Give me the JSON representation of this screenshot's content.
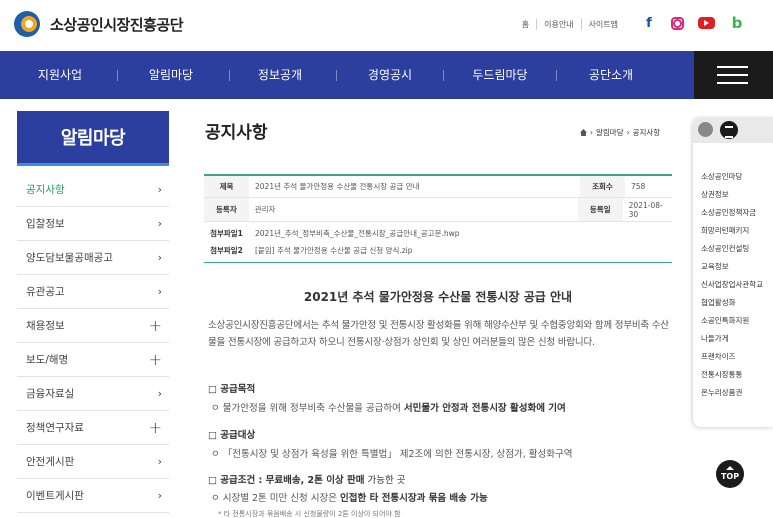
{
  "header": {
    "logo_text": "소상공인시장진흥공단",
    "top_links": [
      "홈",
      "이용안내",
      "사이트맵"
    ],
    "sns": [
      "facebook-icon",
      "instagram-icon",
      "youtube-icon",
      "blog-icon"
    ]
  },
  "nav": {
    "items": [
      "지원사업",
      "알림마당",
      "정보공개",
      "경영공시",
      "두드림마당",
      "공단소개"
    ]
  },
  "sidebar": {
    "title": "알림마당",
    "items": [
      {
        "label": "공지사항",
        "icon": "›"
      },
      {
        "label": "입찰정보",
        "icon": "›"
      },
      {
        "label": "양도담보물공매공고",
        "icon": "›"
      },
      {
        "label": "유관공고",
        "icon": "›"
      },
      {
        "label": "채용정보",
        "icon": "+"
      },
      {
        "label": "보도/해명",
        "icon": "+"
      },
      {
        "label": "금융자료실",
        "icon": "›"
      },
      {
        "label": "정책연구자료",
        "icon": "+"
      },
      {
        "label": "안전게시판",
        "icon": "›"
      },
      {
        "label": "이벤트게시판",
        "icon": "›"
      }
    ]
  },
  "main": {
    "title": "공지사항",
    "breadcrumb": [
      "알림마당",
      "공지사항"
    ],
    "info": {
      "subject_label": "제목",
      "subject": "2021년 추석 물가안정용 수산물 전통시장 공급 안내",
      "views_label": "조회수",
      "views": "758",
      "author_label": "등록자",
      "author": "관리자",
      "date_label": "등록일",
      "date": "2021-08-30",
      "file1_label": "첨부파일1",
      "file1": "2021년_추석_정부비축_수산물_전통시장_공급안내_공고문.hwp",
      "file2_label": "첨부파일2",
      "file2": "[붙임] 추석 물가안정용 수산물 공급 신청 양식.zip"
    },
    "article": {
      "title": "2021년 추석 물가안정용 수산물 전통시장 공급 안내",
      "paragraph": "소상공인시장진흥공단에서는 추석 물가안정 및 전통시장 활성화를 위해 해양수산부 및 수협중앙회와 함께 정부비축 수산물을 전통시장에 공급하고자 하오니 전통시장·상점가 상인회 및 상인 여러분들의 많은 신청 바랍니다.",
      "sec1": "□ 공급목적",
      "sec1_bullet_a": "ㅇ 물가안정을 위해 정부비축 수산물을 공급하여 ",
      "sec1_bullet_b": "서민물가 안정과 전통시장 활성화에 기여",
      "sec2": "□ 공급대상",
      "sec2_bullet": "ㅇ 「전통시장 및 상점가 육성을 위한 특별법」 제2조에 의한 전통시장, 상점가, 활성화구역",
      "sec3_a": "□ 공급조건 : 무료배송, 2톤 이상 판매",
      "sec3_b": " 가능한 곳",
      "sec3_bullet_a": "ㅇ 시장별 2톤 미만 신청 시장은 ",
      "sec3_bullet_b": "인접한 타 전통시장과 묶음 배송 가능",
      "note": "* 타 전통시장과 묶음배송 시 신청물량이 2톤 이상이 되어야 함"
    }
  },
  "quick": {
    "items": [
      "소상공인마당",
      "상권정보",
      "소상공인정책자금",
      "희망리턴패키지",
      "소상공인컨설팅",
      "교육정보",
      "신사업창업사관학교",
      "협업활성화",
      "소공인특화지원",
      "나들가게",
      "프랜차이즈",
      "전통시장통통",
      "온누리상품권"
    ],
    "top_label": "TOP"
  }
}
